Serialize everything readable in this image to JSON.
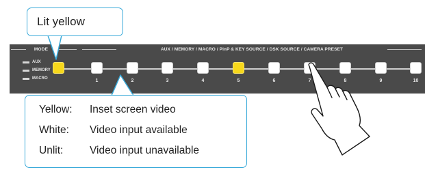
{
  "mode_section": {
    "label": "MODE",
    "options": [
      "AUX",
      "MEMORY",
      "MACRO"
    ]
  },
  "bus_title": "AUX / MEMORY / MACRO / PinP & KEY SOURCE / DSK SOURCE / CAMERA PRESET",
  "buttons": [
    {
      "number": "1",
      "state": "unlit"
    },
    {
      "number": "2",
      "state": "unlit"
    },
    {
      "number": "3",
      "state": "unlit"
    },
    {
      "number": "4",
      "state": "unlit"
    },
    {
      "number": "5",
      "state": "yellow"
    },
    {
      "number": "6",
      "state": "unlit"
    },
    {
      "number": "7",
      "state": "unlit"
    },
    {
      "number": "8",
      "state": "unlit"
    },
    {
      "number": "9",
      "state": "unlit"
    },
    {
      "number": "10",
      "state": "unlit"
    }
  ],
  "mode_button_state": "yellow",
  "callout_top": {
    "text": "Lit yellow"
  },
  "callout_bottom": {
    "rows": [
      {
        "key": "Yellow:",
        "value": "Inset screen video"
      },
      {
        "key": "White:",
        "value": "Video input available"
      },
      {
        "key": "Unlit:",
        "value": "Video input unavailable"
      }
    ]
  },
  "colors": {
    "panel": "#4a4a4a",
    "lit_yellow": "#f7d81c",
    "callout_border": "#38a9d9"
  }
}
